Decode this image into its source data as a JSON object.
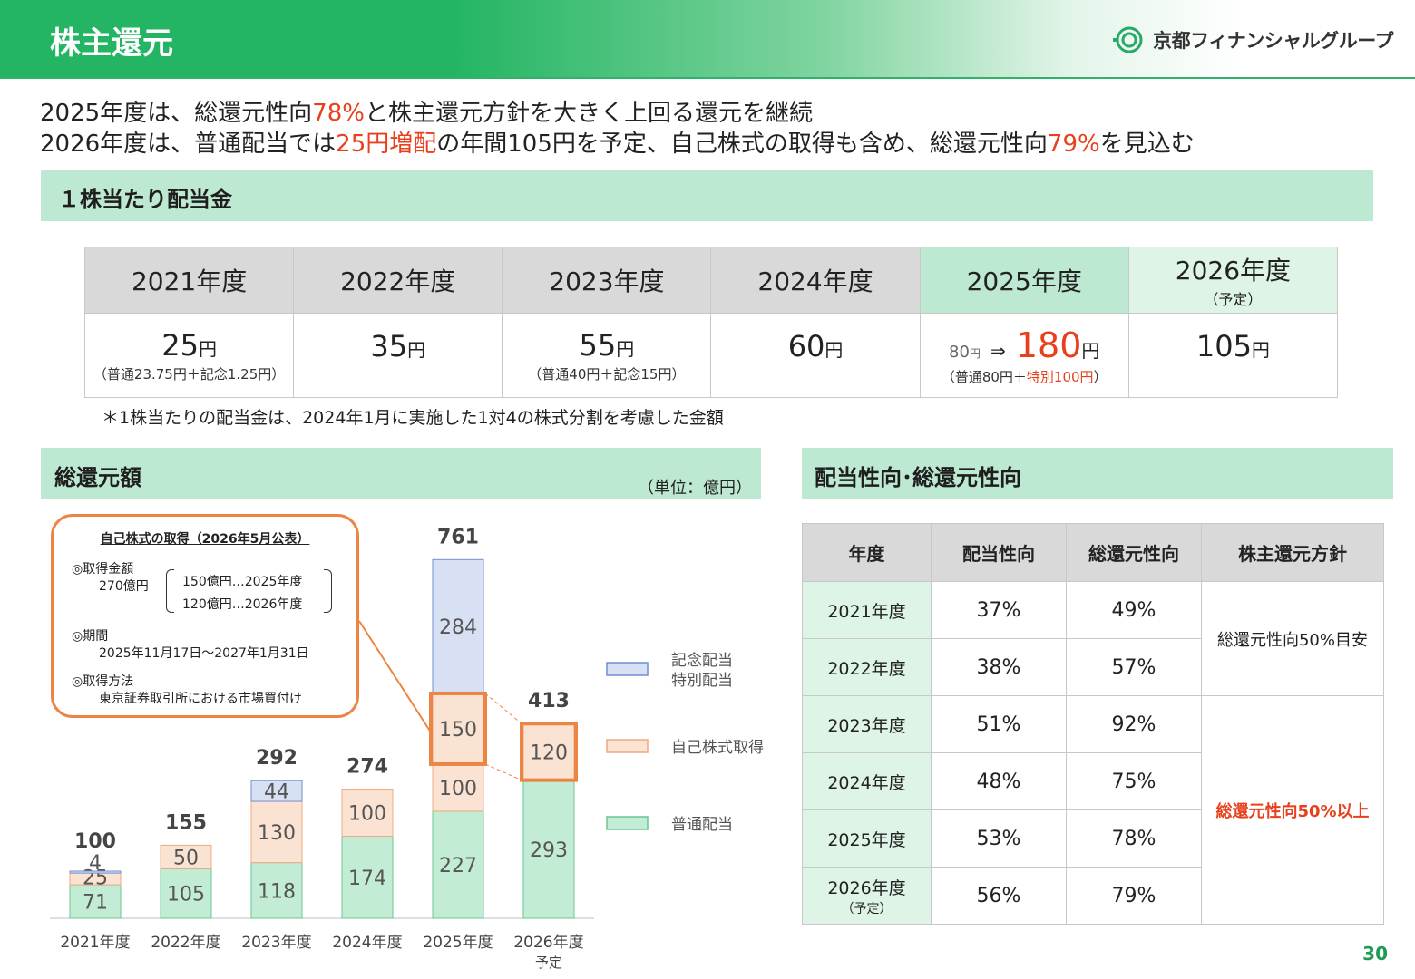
{
  "header": {
    "title": "株主還元",
    "logo_text": "京都フィナンシャルグループ"
  },
  "lead": {
    "line1_a": "2025年度は、総還元性向",
    "line1_b": "78%",
    "line1_c": "と株主還元方針を大きく上回る還元を継続",
    "line2_a": "2026年度は、普通配当では",
    "line2_b": "25円増配",
    "line2_c": "の年間105円を予定、自己株式の取得も含め、総還元性向",
    "line2_d": "79%",
    "line2_e": "を見込む"
  },
  "dividend_section": {
    "title": "１株当たり配当金",
    "years": [
      "2021年度",
      "2022年度",
      "2023年度",
      "2024年度",
      "2025年度",
      "2026年度"
    ],
    "plan_note": "（予定）",
    "unit": "円",
    "amounts": [
      "25",
      "35",
      "55",
      "60",
      "180",
      "105"
    ],
    "prev_2025": "80",
    "arrow": "⇒",
    "breakdowns": [
      "（普通23.75円＋記念1.25円）",
      "",
      "（普通40円＋記念15円）",
      "",
      "",
      ""
    ],
    "breakdown_2025_a": "（普通80円＋",
    "breakdown_2025_b": "特別100円",
    "breakdown_2025_c": "）",
    "note": "＊1株当たりの配当金は、2024年1月に実施した1対4の株式分割を考慮した金額"
  },
  "total_return_section": {
    "title": "総還元額",
    "unit": "（単位：億円）"
  },
  "ratio_section": {
    "title": "配当性向･総還元性向",
    "headers": [
      "年度",
      "配当性向",
      "総還元性向",
      "株主還元方針"
    ],
    "rows": [
      {
        "year": "2021年度",
        "payout": "37%",
        "total": "49%"
      },
      {
        "year": "2022年度",
        "payout": "38%",
        "total": "57%"
      },
      {
        "year": "2023年度",
        "payout": "51%",
        "total": "92%"
      },
      {
        "year": "2024年度",
        "payout": "48%",
        "total": "75%"
      },
      {
        "year": "2025年度",
        "payout": "53%",
        "total": "78%"
      },
      {
        "year": "2026年度",
        "payout": "56%",
        "total": "79%"
      }
    ],
    "plan_note": "（予定）",
    "policy_1": "総還元性向50%目安",
    "policy_2": "総還元性向50%以上"
  },
  "callout": {
    "title": "自己株式の取得（2026年5月公表）",
    "amount_label": "◎取得金額",
    "amount_total": "270億円",
    "amount_line1": "150億円…2025年度",
    "amount_line2": "120億円…2026年度",
    "period_label": "◎期間",
    "period_value": "2025年11月17日～2027年1月31日",
    "method_label": "◎取得方法",
    "method_value": "東京証券取引所における市場買付け"
  },
  "colors": {
    "ordinary": "#c3ecd4",
    "buyback": "#fbe3d3",
    "special": "#d8e1f4",
    "accent_red": "#e8401c",
    "callout_orange": "#ee8443"
  },
  "chart_data": {
    "type": "bar",
    "stacked": true,
    "categories": [
      "2021年度",
      "2022年度",
      "2023年度",
      "2024年度",
      "2025年度",
      "2026年度"
    ],
    "category_sublabels": [
      "",
      "",
      "",
      "",
      "",
      "予定"
    ],
    "series": [
      {
        "name": "普通配当",
        "values": [
          71,
          105,
          118,
          174,
          227,
          293
        ]
      },
      {
        "name": "自己株式取得",
        "values": [
          25,
          50,
          130,
          100,
          250,
          120
        ]
      },
      {
        "name": "記念配当 特別配当",
        "values": [
          4,
          0,
          44,
          0,
          284,
          0
        ]
      }
    ],
    "segment_labels": [
      [
        "71",
        "25",
        "4"
      ],
      [
        "105",
        "50",
        ""
      ],
      [
        "118",
        "130",
        "44"
      ],
      [
        "174",
        "100",
        ""
      ],
      [
        "227",
        "100",
        "150",
        "284"
      ],
      [
        "293",
        "120",
        ""
      ]
    ],
    "totals": [
      "100",
      "155",
      "292",
      "274",
      "761",
      "413"
    ],
    "legend": [
      "記念配当",
      "特別配当",
      "自己株式取得",
      "普通配当"
    ],
    "legend_position": "right",
    "ylim": [
      0,
      800
    ]
  },
  "page_number": "30"
}
